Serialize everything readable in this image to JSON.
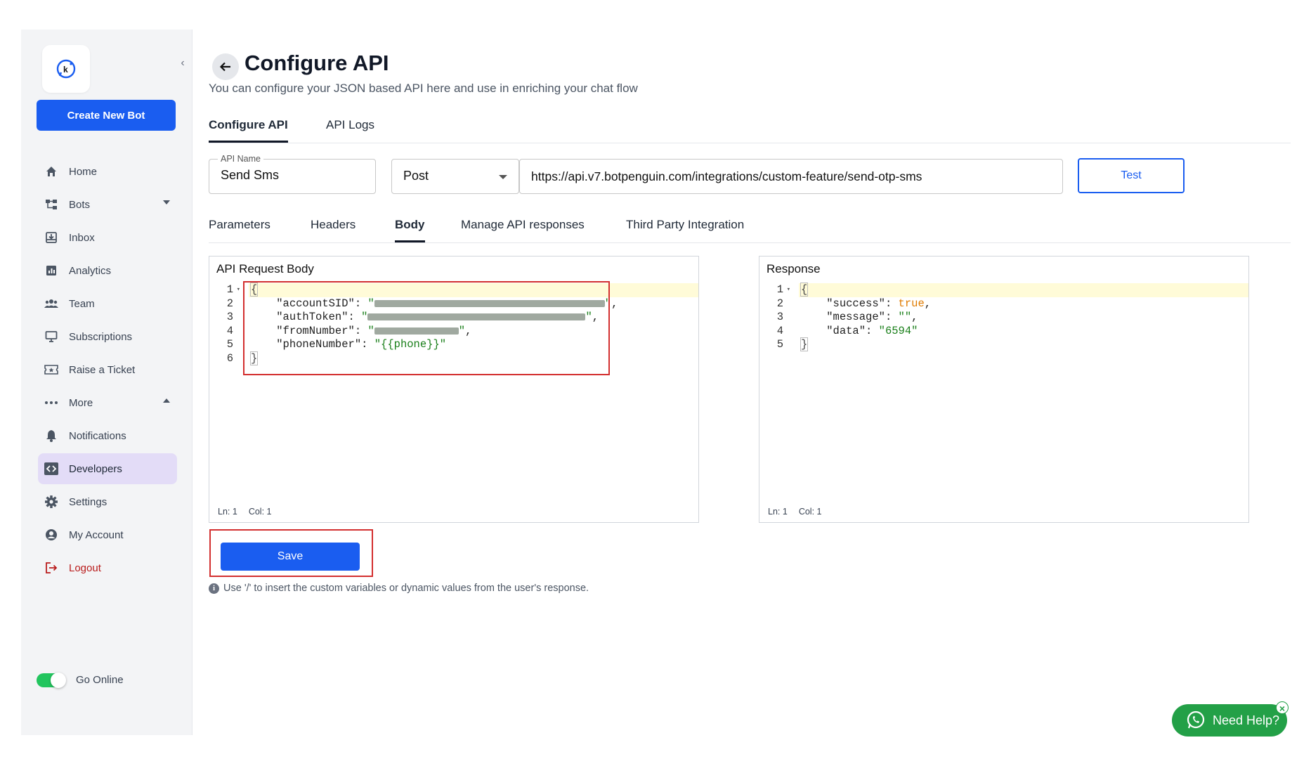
{
  "sidebar": {
    "create_label": "Create New Bot",
    "items": [
      {
        "label": "Home",
        "icon": "home-icon"
      },
      {
        "label": "Bots",
        "icon": "bots-icon"
      },
      {
        "label": "Inbox",
        "icon": "inbox-icon"
      },
      {
        "label": "Analytics",
        "icon": "analytics-icon"
      },
      {
        "label": "Team",
        "icon": "team-icon"
      },
      {
        "label": "Subscriptions",
        "icon": "subscriptions-icon"
      },
      {
        "label": "Raise a Ticket",
        "icon": "ticket-icon"
      },
      {
        "label": "More",
        "icon": "more-icon"
      },
      {
        "label": "Notifications",
        "icon": "bell-icon"
      },
      {
        "label": "Developers",
        "icon": "code-icon"
      },
      {
        "label": "Settings",
        "icon": "gear-icon"
      },
      {
        "label": "My Account",
        "icon": "account-icon"
      },
      {
        "label": "Logout",
        "icon": "logout-icon"
      }
    ],
    "go_online_label": "Go Online",
    "go_online_enabled": true,
    "active_item": "Developers"
  },
  "header": {
    "title": "Configure API",
    "subtitle": "You can configure your JSON based API here and use in enriching your chat flow"
  },
  "tabs": [
    {
      "label": "Configure API",
      "active": true
    },
    {
      "label": "API Logs",
      "active": false
    }
  ],
  "form": {
    "api_name_label": "API Name",
    "api_name_value": "Send Sms",
    "method_value": "Post",
    "url_value": "https://api.v7.botpenguin.com/integrations/custom-feature/send-otp-sms",
    "test_label": "Test"
  },
  "subtabs": [
    {
      "label": "Parameters",
      "active": false
    },
    {
      "label": "Headers",
      "active": false
    },
    {
      "label": "Body",
      "active": true
    },
    {
      "label": "Manage API responses",
      "active": false
    },
    {
      "label": "Third Party Integration",
      "active": false
    }
  ],
  "request_panel": {
    "title": "API Request Body",
    "line_numbers": [
      "1",
      "2",
      "3",
      "4",
      "5",
      "6"
    ],
    "keys": [
      "\"accountSID\"",
      "\"authToken\"",
      "\"fromNumber\"",
      "\"phoneNumber\""
    ],
    "phone_value": "\"{{phone}}\"",
    "ln_label": "Ln: 1",
    "col_label": "Col: 1"
  },
  "response_panel": {
    "title": "Response",
    "line_numbers": [
      "1",
      "2",
      "3",
      "4",
      "5"
    ],
    "success_key": "\"success\"",
    "success_value": "true",
    "message_key": "\"message\"",
    "message_value": "\"\"",
    "data_key": "\"data\"",
    "data_value": "\"6594\"",
    "ln_label": "Ln: 1",
    "col_label": "Col: 1"
  },
  "save_label": "Save",
  "hint": "Use '/' to insert the custom variables or dynamic values from the user's response.",
  "help_label": "Need Help?",
  "colors": {
    "accent": "#1a5df0",
    "active_nav": "#e3dcf7",
    "help": "#23a047",
    "highlight_box": "#d32f2f"
  }
}
